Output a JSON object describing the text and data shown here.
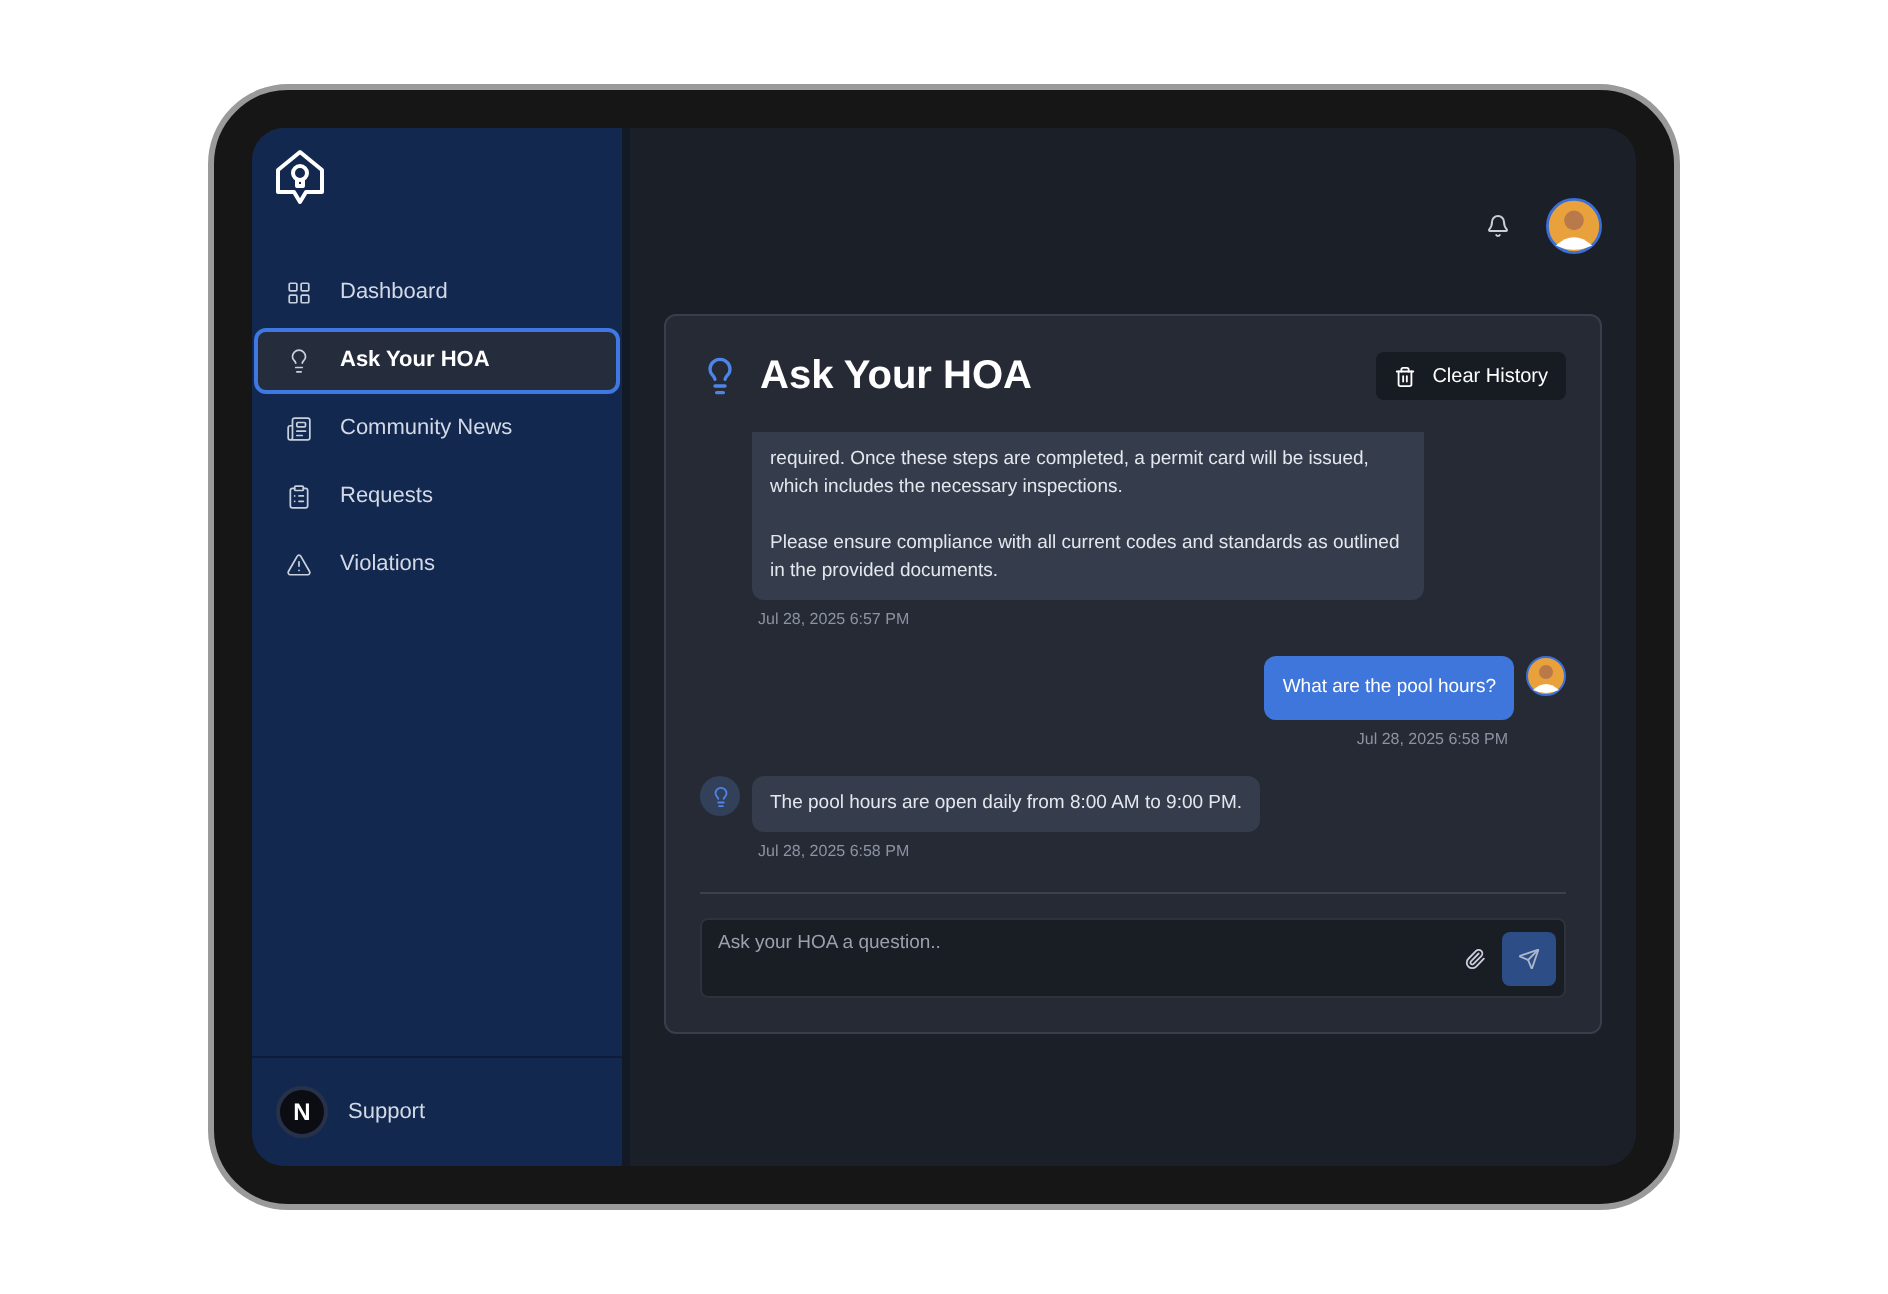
{
  "sidebar": {
    "items": [
      {
        "label": "Dashboard",
        "selected": false
      },
      {
        "label": "Ask Your HOA",
        "selected": true
      },
      {
        "label": "Community News",
        "selected": false
      },
      {
        "label": "Requests",
        "selected": false
      },
      {
        "label": "Violations",
        "selected": false
      }
    ]
  },
  "support": {
    "initial": "N",
    "label": "Support"
  },
  "page": {
    "title": "Ask Your HOA",
    "clear_button": "Clear History"
  },
  "messages": [
    {
      "kind": "bot",
      "paragraphs": [
        "required. Once these steps are completed, a permit card will be issued, which includes the necessary inspections.",
        "Please ensure compliance with all current codes and standards as outlined in the provided documents."
      ],
      "time": "Jul 28, 2025 6:57 PM",
      "avatar": false
    },
    {
      "kind": "user",
      "paragraphs": [
        "What are the pool hours?"
      ],
      "time": "Jul 28, 2025 6:58 PM",
      "avatar": true
    },
    {
      "kind": "bot",
      "paragraphs": [
        "The pool hours are open daily from 8:00 AM to 9:00 PM."
      ],
      "time": "Jul 28, 2025 6:58 PM",
      "avatar": true
    }
  ],
  "composer": {
    "placeholder": "Ask your HOA a question.."
  }
}
